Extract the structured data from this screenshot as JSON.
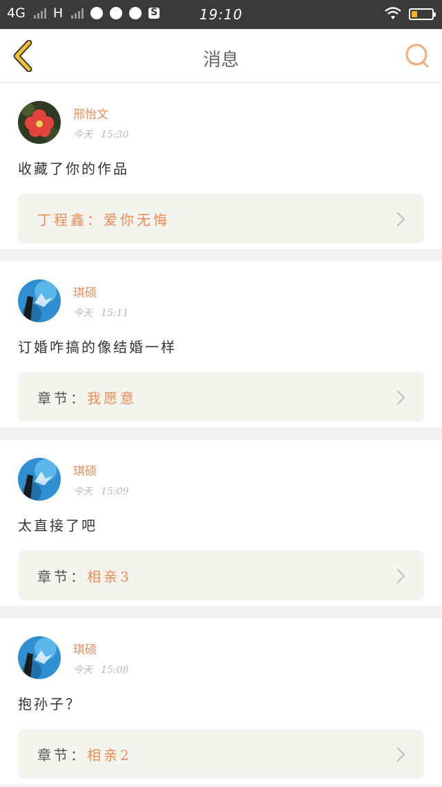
{
  "status_bar": {
    "network_1": "4G",
    "network_2": "H",
    "time": "19:10",
    "battery_level": 0.3,
    "icons": [
      "signal-icon",
      "globe-icon",
      "globe-icon",
      "globe-icon",
      "s-app-icon",
      "wifi-icon",
      "battery-icon"
    ]
  },
  "header": {
    "title": "消息",
    "back_icon": "chevron-left-icon",
    "search_icon": "search-icon"
  },
  "colors": {
    "accent": "#f08a54",
    "back_arrow": "#f2c230",
    "card_bg": "#ffffff",
    "ref_bg": "#f4f4ef"
  },
  "messages": [
    {
      "user": "邢怡文",
      "day": "今天",
      "time": "15:30",
      "text": "收藏了你的作品",
      "ref_label": "",
      "ref_value": "丁程鑫：爱你无悔",
      "avatar": "flower"
    },
    {
      "user": "琪硕",
      "day": "今天",
      "time": "15:11",
      "text": "订婚咋搞的像结婚一样",
      "ref_label": "章节：",
      "ref_value": "我愿意",
      "avatar": "sky"
    },
    {
      "user": "琪硕",
      "day": "今天",
      "time": "15:09",
      "text": "太直接了吧",
      "ref_label": "章节：",
      "ref_value": "相亲3",
      "avatar": "sky"
    },
    {
      "user": "琪硕",
      "day": "今天",
      "time": "15:08",
      "text": "抱孙子？",
      "ref_label": "章节：",
      "ref_value": "相亲2",
      "avatar": "sky"
    }
  ]
}
